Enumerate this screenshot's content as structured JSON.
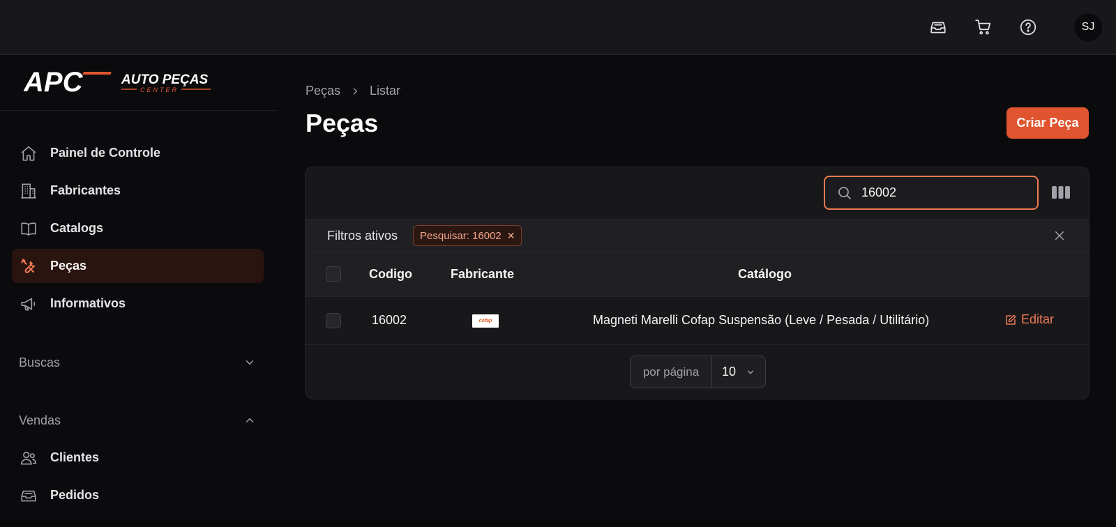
{
  "topbar": {
    "icons": [
      "inbox-icon",
      "cart-icon",
      "help-icon"
    ],
    "avatar_initials": "SJ"
  },
  "brand": {
    "logo_mark": "APC",
    "logo_name": "AUTO PEÇAS",
    "logo_sub": "CENTER",
    "accent_color": "#e0552f"
  },
  "sidebar": {
    "items": [
      {
        "label": "Painel de Controle",
        "icon": "home-icon"
      },
      {
        "label": "Fabricantes",
        "icon": "building-icon"
      },
      {
        "label": "Catalogs",
        "icon": "book-icon"
      },
      {
        "label": "Peças",
        "icon": "wrench-icon",
        "active": true
      },
      {
        "label": "Informativos",
        "icon": "megaphone-icon"
      }
    ],
    "groups": [
      {
        "label": "Buscas",
        "expanded": false
      },
      {
        "label": "Vendas",
        "expanded": true
      }
    ],
    "sales_items": [
      {
        "label": "Clientes",
        "icon": "users-icon"
      },
      {
        "label": "Pedidos",
        "icon": "inbox-icon"
      }
    ]
  },
  "breadcrumb": {
    "items": [
      "Peças",
      "Listar"
    ]
  },
  "page": {
    "title": "Peças",
    "create_label": "Criar Peça"
  },
  "table": {
    "search_value": "16002",
    "filters_label": "Filtros ativos",
    "active_filter": "Pesquisar: 16002",
    "columns": [
      "Codigo",
      "Fabricante",
      "Catálogo"
    ],
    "rows": [
      {
        "codigo": "16002",
        "fabricante_logo": "cofap",
        "catalogo": "Magneti Marelli Cofap Suspensão (Leve / Pesada / Utilitário)",
        "action": "Editar"
      }
    ],
    "per_page_label": "por página",
    "per_page_value": "10"
  }
}
